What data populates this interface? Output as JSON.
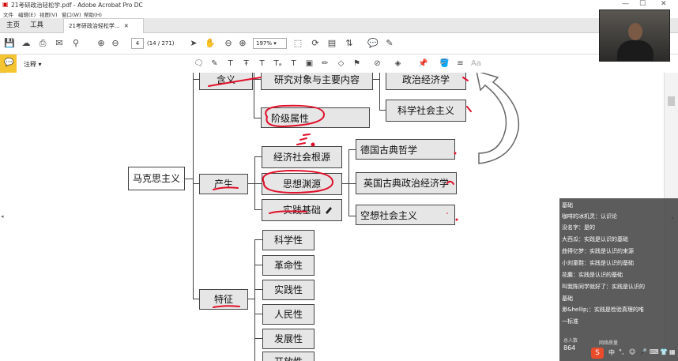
{
  "window": {
    "title": "21考研政治轻松学.pdf - Adobe Acrobat Pro DC"
  },
  "menu": [
    "文件",
    "编辑(E)",
    "视图(V)",
    "窗口(W)",
    "帮助(H)"
  ],
  "tabs": {
    "home": "主页",
    "tools": "工具",
    "doc": "21考研政治轻松学..."
  },
  "toolbar": {
    "page": "4",
    "page_count": "(14 / 271)",
    "zoom": "197%"
  },
  "comment_bar": {
    "label": "注释 ▾"
  },
  "mindmap": {
    "root": "马克思主义",
    "branches": {
      "meaning": "含义",
      "origin": "产生",
      "features": "特征"
    },
    "meaning_children": {
      "research": "研究对象与主要内容",
      "class": "阶级属性",
      "political_economy": "政治经济学",
      "scientific_socialism": "科学社会主义"
    },
    "origin_children": {
      "economic": "经济社会根源",
      "ideological": "思想渊源",
      "practical": "实践基础",
      "german_philosophy": "德国古典哲学",
      "british_economy": "英国古典政治经济学",
      "utopian": "空想社会主义"
    },
    "features": [
      "科学性",
      "革命性",
      "实践性",
      "人民性",
      "发展性",
      "开放性"
    ]
  },
  "chat": {
    "messages": [
      "基础",
      "咖啡的冰机灵：认识论",
      "没名字：是的",
      "大西瓜：实践是认识的基础",
      "曲得亿梦：实践是认识的来源",
      "小刘童鞋：实践是认识的基础",
      "花麋：实践是认识的基础",
      "叫我陈同学就好了：实践是认识的",
      "基础",
      "渺&hellip;：实践是检验真理的唯",
      "一标准"
    ],
    "viewers_label": "总人数",
    "viewers": "864",
    "network_label": "网络质量"
  },
  "colors": {
    "annotation": "#e0102a",
    "highlight_yellow": "#f5c431"
  }
}
